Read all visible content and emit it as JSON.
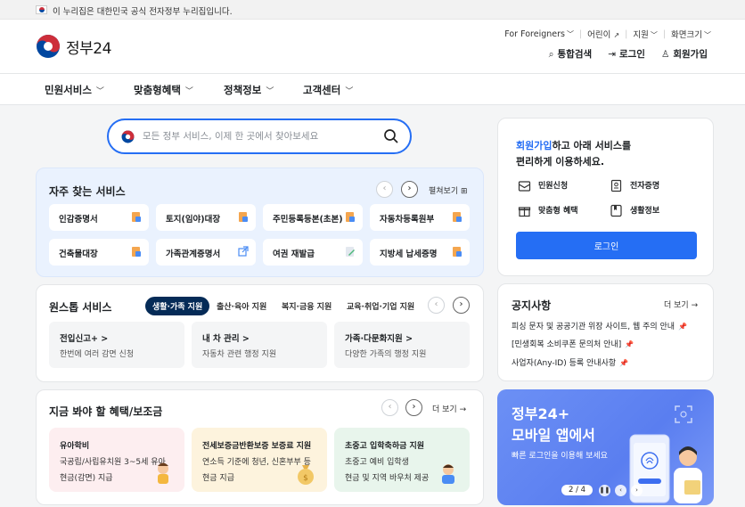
{
  "topbar": {
    "gov_text": "이 누리집은 대한민국 공식 전자정부 누리집입니다."
  },
  "header": {
    "logo_text": "정부24",
    "util": [
      "For Foreigners",
      "어린이",
      "지원",
      "화면크기"
    ],
    "actions": {
      "search": "통합검색",
      "login": "로그인",
      "join": "회원가입"
    }
  },
  "nav": {
    "items": [
      "민원서비스",
      "맞춤형혜택",
      "정책정보",
      "고객센터"
    ]
  },
  "search": {
    "placeholder": "모든 정부 서비스, 이제 한 곳에서 찾아보세요"
  },
  "frequent": {
    "title": "자주 찾는 서비스",
    "expand": "펼쳐보기",
    "items": [
      "인감증명서",
      "토지(임야)대장",
      "주민등록등본(초본)",
      "자동차등록원부",
      "건축물대장",
      "가족관계증명서",
      "여권 재발급",
      "지방세 납세증명"
    ]
  },
  "onestop": {
    "title": "원스톱 서비스",
    "tabs": [
      "생활·가족 지원",
      "출산·육아 지원",
      "복지·금융 지원",
      "교육·취업·기업 지원"
    ],
    "items": [
      {
        "title": "전입신고+ >",
        "desc": "한번에 여러 감면 신청"
      },
      {
        "title": "내 차 관리 >",
        "desc": "자동차 관련 행정 지원"
      },
      {
        "title": "가족·다문화지원 >",
        "desc": "다양한 가족의 행정 지원"
      }
    ]
  },
  "benefits": {
    "title": "지금 봐야 할 혜택/보조금",
    "more": "더 보기",
    "items": [
      {
        "title": "유아학비",
        "line1": "국공립/사립유치원 3~5세 유아",
        "line2": "현금(감면) 지급"
      },
      {
        "title": "전세보증금반환보증 보증료 지원",
        "line1": "연소득 기준에 청년, 신혼부부 등",
        "line2": "현금 지급"
      },
      {
        "title": "초중고 입학축하금 지원",
        "line1": "초중고 예비 입학생",
        "line2": "현금 및 지역 바우처 제공"
      }
    ]
  },
  "login_card": {
    "msg_highlight": "회원가입",
    "msg_rest1": "하고 아래 서비스를",
    "msg_line2": "편리하게 이용하세요.",
    "services": [
      "민원신청",
      "전자증명",
      "맞춤형 혜택",
      "생활정보"
    ],
    "button": "로그인"
  },
  "notice": {
    "title": "공지사항",
    "more": "더 보기",
    "items": [
      "피싱 문자 및 공공기관 위장 사이트, 웹 주의 안내",
      "[민생회복 소비쿠폰 문의처 안내]",
      "사업자(Any-ID) 등록 안내사항"
    ]
  },
  "promo": {
    "title1": "정부24+",
    "title2": "모바일 앱에서",
    "sub": "빠른 로그인을 이용해 보세요",
    "pager": "2 / 4"
  },
  "colors": {
    "primary": "#256ef4",
    "navy": "#052b57",
    "freq_bg": "#eaf2fe"
  }
}
